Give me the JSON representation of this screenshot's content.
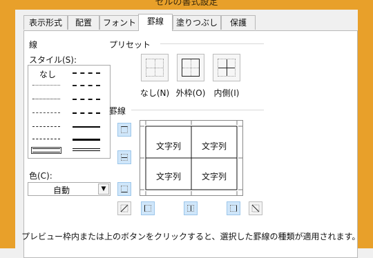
{
  "window": {
    "title": "セルの書式設定"
  },
  "tabs": [
    {
      "label": "表示形式"
    },
    {
      "label": "配置"
    },
    {
      "label": "フォント"
    },
    {
      "label": "罫線"
    },
    {
      "label": "塗りつぶし"
    },
    {
      "label": "保護"
    }
  ],
  "line_group": {
    "title": "線",
    "style_label": "スタイル(S):",
    "none_label": "なし",
    "color_label": "色(C):",
    "color_value": "自動"
  },
  "presets": {
    "title": "プリセット",
    "none": "なし(N)",
    "outline": "外枠(O)",
    "inside": "内側(I)"
  },
  "border": {
    "title": "罫線",
    "cells": [
      "文字列",
      "文字列",
      "文字列",
      "文字列"
    ]
  },
  "footer": {
    "text": "プレビュー枠内または上のボタンをクリックすると、選択した罫線の種類が適用されます。"
  },
  "colors": {
    "frame": "#e8a02a",
    "active_btn": "#cfe6fa"
  }
}
